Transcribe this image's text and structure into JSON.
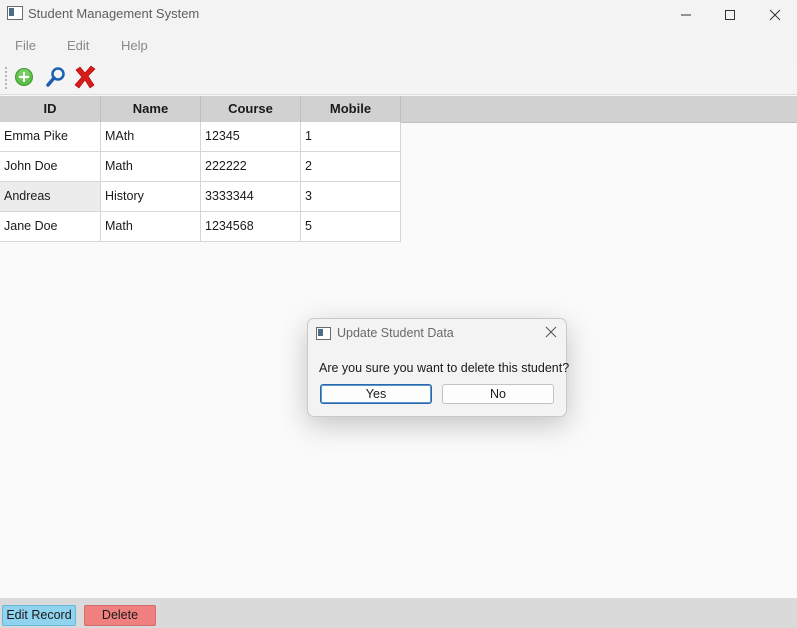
{
  "window": {
    "title": "Student Management System",
    "controls": [
      "minimize-icon",
      "maximize-icon",
      "close-icon"
    ]
  },
  "menu": {
    "items": [
      "File",
      "Edit",
      "Help"
    ]
  },
  "toolbar": {
    "icons": [
      "add-icon",
      "search-icon",
      "delete-icon"
    ],
    "colors": {
      "add": "#4caf50",
      "search": "#1b5fb0",
      "delete": "#d81b1b"
    }
  },
  "table": {
    "columns": [
      "ID",
      "Name",
      "Course",
      "Mobile"
    ],
    "rows": [
      {
        "id": "Emma Pike",
        "name": "MAth",
        "course": "12345",
        "mobile": "1"
      },
      {
        "id": "John Doe",
        "name": "Math",
        "course": "222222",
        "mobile": "2"
      },
      {
        "id": "Andreas",
        "name": "History",
        "course": "3333344",
        "mobile": "3"
      },
      {
        "id": "Jane Doe",
        "name": "Math",
        "course": "1234568",
        "mobile": "5"
      }
    ]
  },
  "footer": {
    "edit_label": "Edit Record",
    "delete_label": "Delete",
    "colors": {
      "edit": "#8fd3ef",
      "delete": "#f08080"
    }
  },
  "dialog": {
    "title": "Update Student Data",
    "message": "Are you sure you want to delete this student?",
    "yes_label": "Yes",
    "no_label": "No"
  }
}
